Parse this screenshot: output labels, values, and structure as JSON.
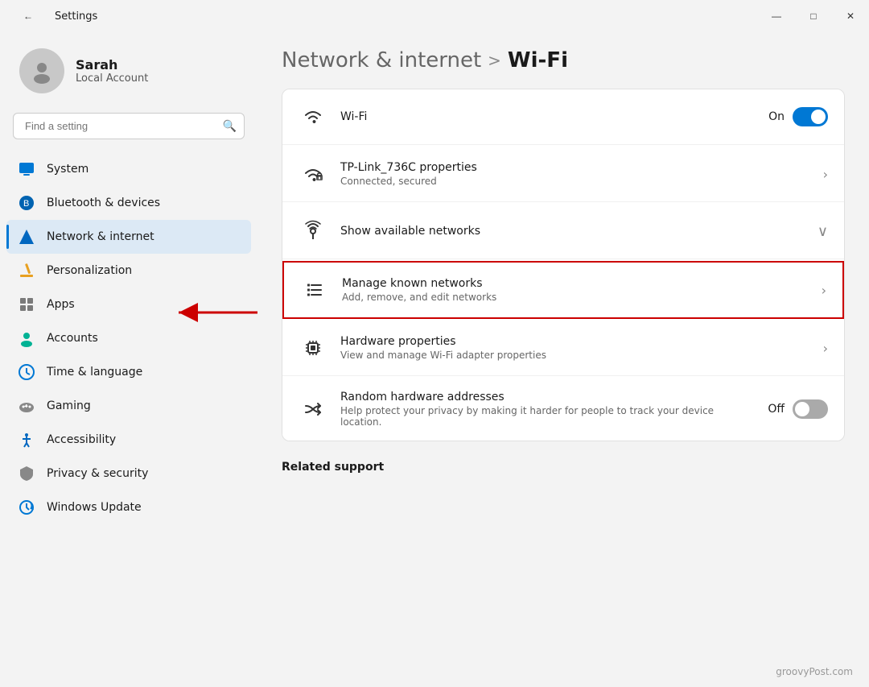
{
  "titlebar": {
    "title": "Settings",
    "back_icon": "←",
    "minimize": "—",
    "maximize": "□",
    "close": "✕"
  },
  "sidebar": {
    "user": {
      "name": "Sarah",
      "account_type": "Local Account"
    },
    "search": {
      "placeholder": "Find a setting"
    },
    "nav_items": [
      {
        "id": "system",
        "label": "System",
        "icon": "🖥",
        "active": false,
        "color": "#0078d4"
      },
      {
        "id": "bluetooth",
        "label": "Bluetooth & devices",
        "icon": "🔵",
        "active": false,
        "color": "#0078d4"
      },
      {
        "id": "network",
        "label": "Network & internet",
        "icon": "💎",
        "active": true,
        "color": "#0067c0"
      },
      {
        "id": "personalization",
        "label": "Personalization",
        "icon": "✏️",
        "active": false
      },
      {
        "id": "apps",
        "label": "Apps",
        "icon": "🧩",
        "active": false
      },
      {
        "id": "accounts",
        "label": "Accounts",
        "icon": "👤",
        "active": false
      },
      {
        "id": "time",
        "label": "Time & language",
        "icon": "🌐",
        "active": false
      },
      {
        "id": "gaming",
        "label": "Gaming",
        "icon": "🎮",
        "active": false
      },
      {
        "id": "accessibility",
        "label": "Accessibility",
        "icon": "♿",
        "active": false
      },
      {
        "id": "privacy",
        "label": "Privacy & security",
        "icon": "🛡",
        "active": false
      },
      {
        "id": "windows_update",
        "label": "Windows Update",
        "icon": "🔄",
        "active": false
      }
    ]
  },
  "content": {
    "breadcrumb_parent": "Network & internet",
    "breadcrumb_sep": ">",
    "breadcrumb_current": "Wi-Fi",
    "cards": [
      {
        "id": "wifi-toggle",
        "title": "Wi-Fi",
        "subtitle": "",
        "toggle": "on",
        "toggle_label": "On",
        "icon": "wifi"
      },
      {
        "id": "tp-link",
        "title": "TP-Link_736C properties",
        "subtitle": "Connected, secured",
        "chevron": "›",
        "icon": "wifi-locked"
      },
      {
        "id": "available-networks",
        "title": "Show available networks",
        "subtitle": "",
        "chevron_down": "∨",
        "icon": "antenna"
      },
      {
        "id": "manage-networks",
        "title": "Manage known networks",
        "subtitle": "Add, remove, and edit networks",
        "chevron": "›",
        "icon": "list",
        "highlighted": true
      },
      {
        "id": "hardware-properties",
        "title": "Hardware properties",
        "subtitle": "View and manage Wi-Fi adapter properties",
        "chevron": "›",
        "icon": "chip"
      },
      {
        "id": "random-hardware",
        "title": "Random hardware addresses",
        "subtitle": "Help protect your privacy by making it harder for people to track your device location.",
        "toggle": "off",
        "toggle_label": "Off",
        "icon": "shuffle"
      }
    ],
    "related_support": "Related support",
    "watermark": "groovyPost.com"
  }
}
